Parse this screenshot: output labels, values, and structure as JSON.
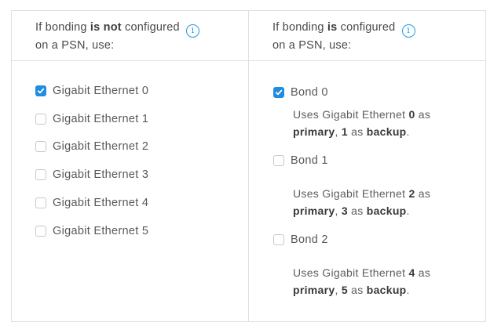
{
  "left_header": {
    "line1_prefix": "If bonding ",
    "line1_bold": "is not",
    "line1_suffix": " configured",
    "line2": "on a PSN, use:",
    "info_glyph": "i"
  },
  "right_header": {
    "line1_prefix": "If bonding ",
    "line1_bold": "is",
    "line1_suffix": " configured",
    "line2": "on a PSN, use:",
    "info_glyph": "i"
  },
  "interfaces": [
    {
      "label": "Gigabit Ethernet 0",
      "checked": true
    },
    {
      "label": "Gigabit Ethernet 1",
      "checked": false
    },
    {
      "label": "Gigabit Ethernet 2",
      "checked": false
    },
    {
      "label": "Gigabit Ethernet 3",
      "checked": false
    },
    {
      "label": "Gigabit Ethernet 4",
      "checked": false
    },
    {
      "label": "Gigabit Ethernet 5",
      "checked": false
    }
  ],
  "bonds": [
    {
      "label": "Bond 0",
      "checked": true,
      "desc_prefix": "Uses Gigabit Ethernet ",
      "primary_port": "0",
      "desc_as1": " as",
      "primary_word": "primary",
      "sep": ", ",
      "backup_port": "1",
      "desc_as2": " as ",
      "backup_word": "backup",
      "end": "."
    },
    {
      "label": "Bond 1",
      "checked": false,
      "desc_prefix": "Uses Gigabit Ethernet ",
      "primary_port": "2",
      "desc_as1": " as",
      "primary_word": "primary",
      "sep": ", ",
      "backup_port": "3",
      "desc_as2": " as ",
      "backup_word": "backup",
      "end": "."
    },
    {
      "label": "Bond 2",
      "checked": false,
      "desc_prefix": "Uses Gigabit Ethernet ",
      "primary_port": "4",
      "desc_as1": " as",
      "primary_word": "primary",
      "sep": ", ",
      "backup_port": "5",
      "desc_as2": " as ",
      "backup_word": "backup",
      "end": "."
    }
  ],
  "colors": {
    "accent": "#1f8de0",
    "info": "#1e9be6",
    "border": "#dfdfdf"
  }
}
